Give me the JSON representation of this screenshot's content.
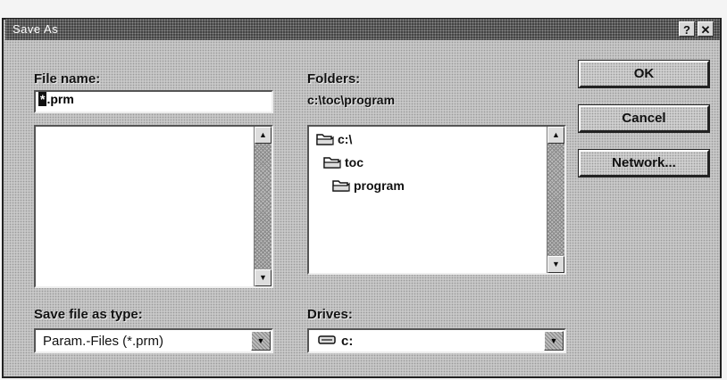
{
  "window": {
    "title": "Save As",
    "help_glyph": "?",
    "close_glyph": "✕"
  },
  "file_name": {
    "label": "File name:",
    "value": ".prm",
    "selected_prefix": "*"
  },
  "folders": {
    "label": "Folders:",
    "current_path": "c:\\toc\\program",
    "items": [
      {
        "label": "c:\\",
        "icon": "open-folder-icon"
      },
      {
        "label": "toc",
        "icon": "open-folder-icon"
      },
      {
        "label": "program",
        "icon": "open-folder-icon"
      }
    ]
  },
  "buttons": {
    "ok": "OK",
    "cancel": "Cancel",
    "network": "Network..."
  },
  "save_type": {
    "label": "Save file as type:",
    "value": "Param.-Files (*.prm)"
  },
  "drives": {
    "label": "Drives:",
    "value": "c:",
    "icon": "drive-icon"
  },
  "scroll_glyphs": {
    "up": "▲",
    "down": "▼"
  }
}
